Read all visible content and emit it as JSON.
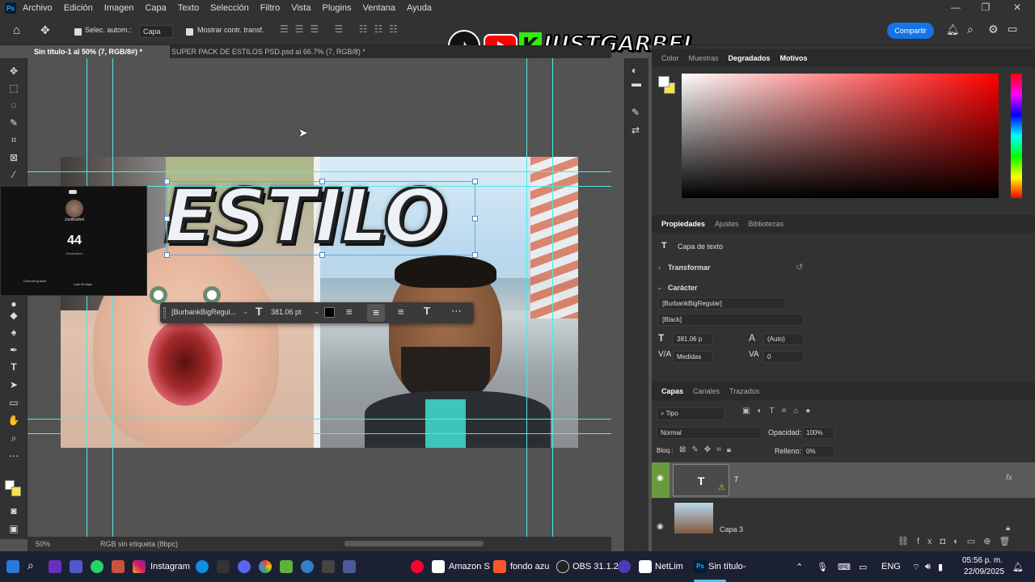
{
  "menu": [
    "Archivo",
    "Edición",
    "Imagen",
    "Capa",
    "Texto",
    "Selección",
    "Filtro",
    "Vista",
    "Plugins",
    "Ventana",
    "Ayuda"
  ],
  "app_icon": "Ps",
  "options": {
    "auto_select_label": "Selec. autom.:",
    "auto_select_value": "Capa",
    "show_transform_label": "Mostrar contr. transf.",
    "share_button": "Compartir"
  },
  "tabs": [
    {
      "label": "Sin título-1 al 50% (7, RGB/8#) *",
      "active": true
    },
    {
      "label": "SUPER PACK DE ESTILOS PSD.psd al 66.7% (7, RGB/8) *",
      "active": false
    }
  ],
  "watermark": {
    "brand": "JUSTGARBEL"
  },
  "canvas": {
    "headline": "ESTILO",
    "context_font": "[BurbankBigRegul...",
    "context_size": "381.06 pt"
  },
  "overlay_window": {
    "channel": "Justibarbel",
    "count": "44",
    "count_label": "Subscribers",
    "footer_left": "Channel growth",
    "footer_right": "Last 28 days"
  },
  "status": {
    "zoom": "50%",
    "color_profile": "RGB sin etiqueta (8bpc)"
  },
  "color_panel": {
    "tabs": [
      "Color",
      "Muestras",
      "Degradados",
      "Motivos"
    ]
  },
  "properties": {
    "tabs": [
      "Propiedades",
      "Ajustes",
      "Bibliotecas"
    ],
    "layer_type": "Capa de texto",
    "transform_label": "Transformar",
    "character_label": "Carácter",
    "font_family": "[BurbankBigRegular]",
    "font_style": "[Black]",
    "font_size": "381.06 p",
    "leading": "(Auto)",
    "kerning": "Medidas",
    "tracking": "0"
  },
  "layers": {
    "tabs": [
      "Capas",
      "Canales",
      "Trazados"
    ],
    "filter": "Tipo",
    "blend_mode": "Normal",
    "opacity_label": "Opacidad:",
    "opacity": "100%",
    "lock_label": "Bloq.:",
    "fill_label": "Relleno:",
    "fill": "0%",
    "items": [
      {
        "name": "7",
        "type": "text"
      },
      {
        "name": "Capa 3",
        "type": "image"
      }
    ]
  },
  "taskbar": {
    "apps": [
      "Instagram",
      "Amazon S",
      "fondo azu",
      "OBS 31.1.2",
      "NetLim",
      "Sin título-"
    ],
    "language": "ENG",
    "time": "05:56 p. m.",
    "date": "22/09/2025"
  }
}
